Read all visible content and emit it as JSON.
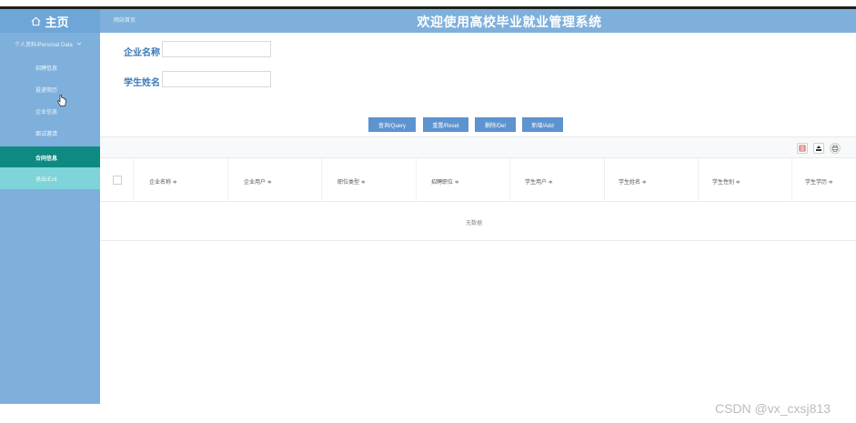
{
  "header": {
    "home_label": "主页",
    "site_link": "网站首页",
    "title": "欢迎使用高校毕业就业管理系统"
  },
  "sidebar": {
    "group_label": "个人资料/Personal Data",
    "items": [
      {
        "label": "招聘信息"
      },
      {
        "label": "投递简历"
      },
      {
        "label": "企业信息"
      },
      {
        "label": "面试邀请"
      },
      {
        "label": "合同信息"
      },
      {
        "label": "退出/Exit"
      }
    ],
    "active_index": 4
  },
  "search": {
    "company_label": "企业名称",
    "company_value": "",
    "student_label": "学生姓名",
    "student_value": ""
  },
  "buttons": {
    "query": "查询/Query",
    "reset": "重置/Reset",
    "delete": "删除/Del",
    "add": "新增/Add"
  },
  "table": {
    "columns": [
      "企业名称 ≑",
      "企业用户 ≑",
      "职位类型 ≑",
      "招聘职位 ≑",
      "学生用户 ≑",
      "学生姓名 ≑",
      "学生性别 ≑",
      "学生学历 ≑"
    ],
    "empty_text": "无数据"
  },
  "watermark": "CSDN @vx_cxsj813",
  "colors": {
    "header_bg": "#7fb0dc",
    "active_item": "#0e8a83",
    "logout_item": "#7ed4d8",
    "button_bg": "#5d93cf",
    "label_text": "#3b79b5"
  }
}
